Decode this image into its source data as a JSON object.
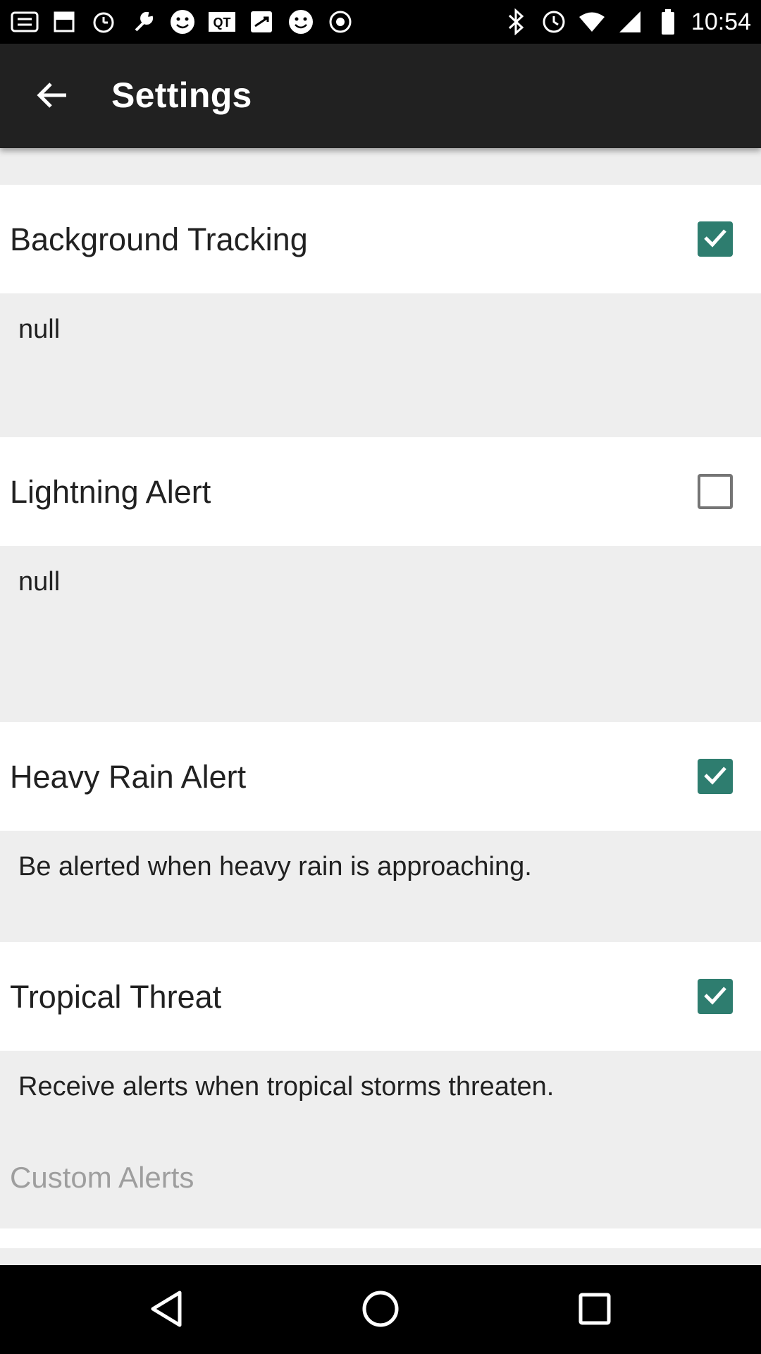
{
  "status_bar": {
    "time": "10:54",
    "left_icons": [
      "app-icon",
      "notification-icon",
      "alarm-icon",
      "wrench-icon",
      "smiley-icon",
      "qt-icon",
      "shuffle-icon",
      "smiley-icon",
      "record-icon"
    ],
    "right_icons": [
      "bluetooth-icon",
      "clock-icon",
      "wifi-icon",
      "cell-signal-icon",
      "battery-icon"
    ]
  },
  "app_bar": {
    "title": "Settings"
  },
  "settings": [
    {
      "title": "Background Tracking",
      "checked": true,
      "description": "null"
    },
    {
      "title": "Lightning Alert",
      "checked": false,
      "description": "null"
    },
    {
      "title": "Heavy Rain Alert",
      "checked": true,
      "description": "Be alerted when heavy rain is approaching."
    },
    {
      "title": "Tropical Threat",
      "checked": true,
      "description": "Receive alerts when tropical storms threaten."
    }
  ],
  "section": {
    "custom_alerts_label": "Custom Alerts"
  },
  "colors": {
    "app_bar": "#212121",
    "checkbox_checked": "#2e7d6f",
    "background": "#eeeeee",
    "section_header_text": "#9e9e9e"
  }
}
